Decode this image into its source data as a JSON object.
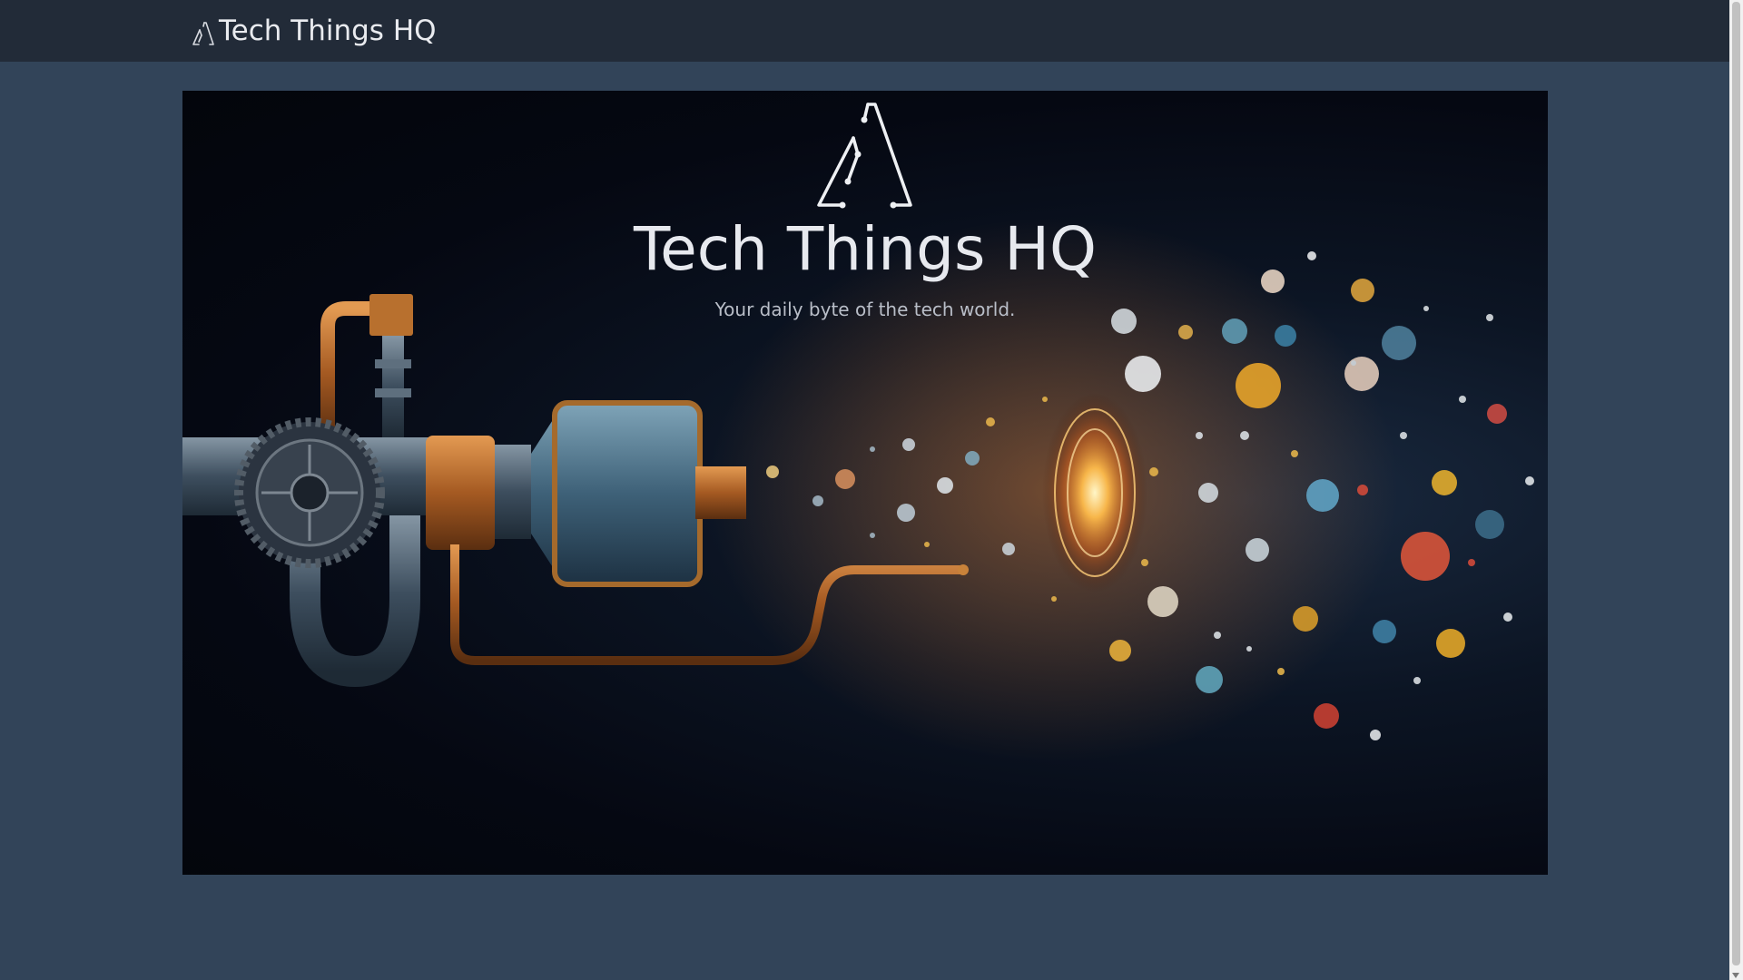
{
  "navbar": {
    "brand_name": "Tech Things HQ",
    "brand_icon": "tech-things-logo-icon"
  },
  "hero": {
    "logo_icon": "tech-things-logo-icon",
    "title": "Tech Things HQ",
    "tagline": "Your daily byte of the tech world.",
    "image_description_icon": "pipe-machine-data-burst-illustration"
  },
  "colors": {
    "page_background": "#324459",
    "navbar_background": "#222b38",
    "hero_background": "#03050b",
    "text": "#e7e9ee"
  }
}
